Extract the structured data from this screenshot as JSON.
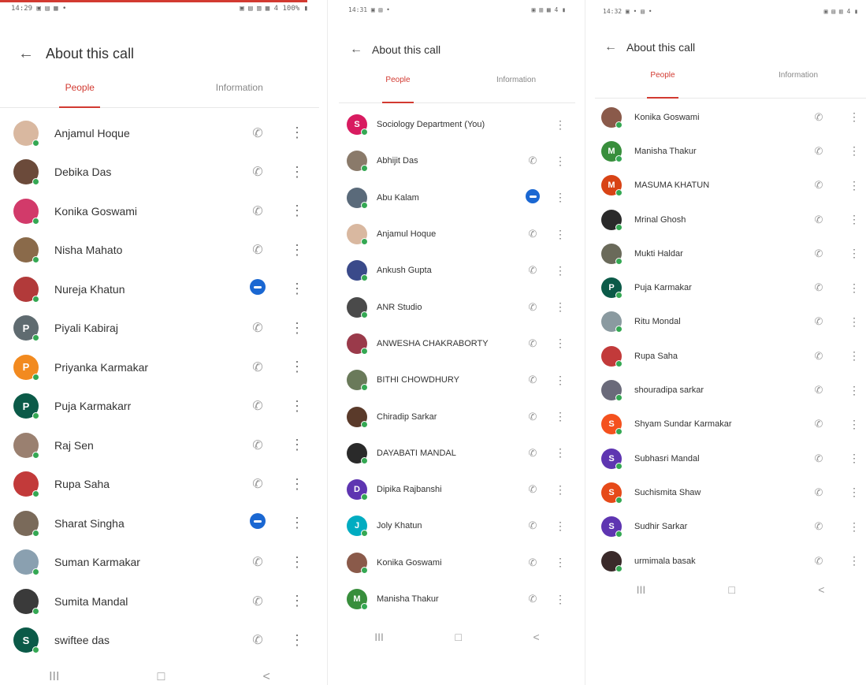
{
  "colors": {
    "accent": "#d23a31",
    "online": "#34a853",
    "meet": "#1a67d2"
  },
  "icons": {
    "back": "arrow-left-icon",
    "call": "phone-off-icon",
    "more": "more-vert-icon",
    "meet": "meet-icon"
  },
  "nav": {
    "recent": "III",
    "home": "□",
    "back": "<"
  },
  "screens": [
    {
      "status_left": "14:29 ▣ ▤ ▦ •",
      "status_right": "▣ ▤ ▥ ▦ 4 100% ▮",
      "title": "About this call",
      "tabs": [
        "People",
        "Information"
      ],
      "people": [
        {
          "name": "Anjamul Hoque",
          "initial": "",
          "color": "#d9b8a0",
          "action": "call"
        },
        {
          "name": "Debika Das",
          "initial": "",
          "color": "#6b4a3a",
          "action": "call"
        },
        {
          "name": "Konika Goswami",
          "initial": "",
          "color": "#d23a6a",
          "action": "call"
        },
        {
          "name": "Nisha Mahato",
          "initial": "",
          "color": "#8a6a4a",
          "action": "call"
        },
        {
          "name": "Nureja Khatun",
          "initial": "",
          "color": "#b23a3a",
          "action": "meet"
        },
        {
          "name": "Piyali Kabiraj",
          "initial": "P",
          "color": "#5f6b70",
          "action": "call"
        },
        {
          "name": "Priyanka Karmakar",
          "initial": "P",
          "color": "#f28a1f",
          "action": "call"
        },
        {
          "name": "Puja Karmakarr",
          "initial": "P",
          "color": "#0b5a48",
          "action": "call"
        },
        {
          "name": "Raj Sen",
          "initial": "",
          "color": "#9a8070",
          "action": "call"
        },
        {
          "name": "Rupa Saha",
          "initial": "",
          "color": "#c23a3a",
          "action": "call"
        },
        {
          "name": "Sharat Singha",
          "initial": "",
          "color": "#7a6a5a",
          "action": "meet"
        },
        {
          "name": "Suman Karmakar",
          "initial": "",
          "color": "#8aa0b0",
          "action": "call"
        },
        {
          "name": "Sumita Mandal",
          "initial": "",
          "color": "#3a3a3a",
          "action": "call"
        },
        {
          "name": "swiftee das",
          "initial": "S",
          "color": "#0b5a48",
          "action": "call"
        }
      ]
    },
    {
      "status_left": "14:31 ▣ ▤ •",
      "status_right": "▣ ▥ ▦ 4 ▮",
      "title": "About this call",
      "tabs": [
        "People",
        "Information"
      ],
      "people": [
        {
          "name": "Sociology Department (You)",
          "initial": "S",
          "color": "#d81b60",
          "action": "none"
        },
        {
          "name": "Abhijit Das",
          "initial": "",
          "color": "#8a7a6a",
          "action": "call"
        },
        {
          "name": "Abu Kalam",
          "initial": "",
          "color": "#5a6a7a",
          "action": "meet"
        },
        {
          "name": "Anjamul Hoque",
          "initial": "",
          "color": "#d9b8a0",
          "action": "call"
        },
        {
          "name": "Ankush Gupta",
          "initial": "",
          "color": "#3a4a8a",
          "action": "call"
        },
        {
          "name": "ANR Studio",
          "initial": "",
          "color": "#4a4a4a",
          "action": "call"
        },
        {
          "name": "ANWESHA CHAKRABORTY",
          "initial": "",
          "color": "#9a3a4a",
          "action": "call"
        },
        {
          "name": "BITHI CHOWDHURY",
          "initial": "",
          "color": "#6a7a5a",
          "action": "call"
        },
        {
          "name": "Chiradip Sarkar",
          "initial": "",
          "color": "#5a3a2a",
          "action": "call"
        },
        {
          "name": "DAYABATI MANDAL",
          "initial": "",
          "color": "#2a2a2a",
          "action": "call"
        },
        {
          "name": "Dipika Rajbanshi",
          "initial": "D",
          "color": "#5e35b1",
          "action": "call"
        },
        {
          "name": "Joly Khatun",
          "initial": "J",
          "color": "#00acc1",
          "action": "call"
        },
        {
          "name": "Konika Goswami",
          "initial": "",
          "color": "#8a5a4a",
          "action": "call"
        },
        {
          "name": "Manisha Thakur",
          "initial": "M",
          "color": "#388e3c",
          "action": "call"
        }
      ]
    },
    {
      "status_left": "14:32 ▣ • ▤ •",
      "status_right": "▣ ▤ ▥ 4 ▮",
      "title": "About this call",
      "tabs": [
        "People",
        "Information"
      ],
      "people": [
        {
          "name": "Konika Goswami",
          "initial": "",
          "color": "#8a5a4a",
          "action": "call"
        },
        {
          "name": "Manisha Thakur",
          "initial": "M",
          "color": "#388e3c",
          "action": "call"
        },
        {
          "name": "MASUMA KHATUN",
          "initial": "M",
          "color": "#d84315",
          "action": "call"
        },
        {
          "name": "Mrinal Ghosh",
          "initial": "",
          "color": "#2a2a2a",
          "action": "call"
        },
        {
          "name": "Mukti Haldar",
          "initial": "",
          "color": "#6a6a5a",
          "action": "call"
        },
        {
          "name": "Puja Karmakar",
          "initial": "P",
          "color": "#0b5a48",
          "action": "call"
        },
        {
          "name": "Ritu Mondal",
          "initial": "",
          "color": "#8a9aa0",
          "action": "call"
        },
        {
          "name": "Rupa Saha",
          "initial": "",
          "color": "#c23a3a",
          "action": "call"
        },
        {
          "name": "shouradipa sarkar",
          "initial": "",
          "color": "#6a6a7a",
          "action": "call"
        },
        {
          "name": "Shyam Sundar Karmakar",
          "initial": "S",
          "color": "#f4511e",
          "action": "call"
        },
        {
          "name": "Subhasri Mandal",
          "initial": "S",
          "color": "#5e35b1",
          "action": "call"
        },
        {
          "name": "Suchismita Shaw",
          "initial": "S",
          "color": "#e64a19",
          "action": "call"
        },
        {
          "name": "Sudhir Sarkar",
          "initial": "S",
          "color": "#5e35b1",
          "action": "call"
        },
        {
          "name": "urmimala basak",
          "initial": "",
          "color": "#3a2a2a",
          "action": "call"
        }
      ]
    }
  ]
}
